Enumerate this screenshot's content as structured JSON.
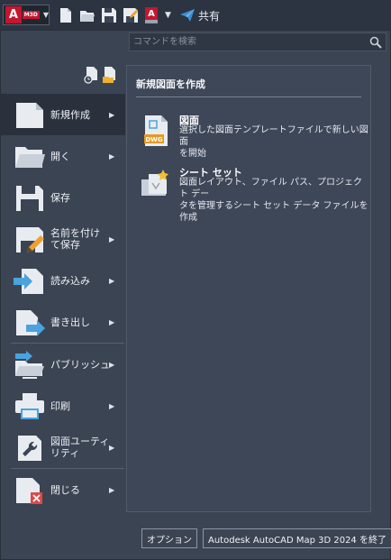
{
  "titlebar": {
    "app_logo": "A",
    "app_tag": "M3D",
    "qa_tag": "A",
    "share_label": "共有",
    "quick_access_icons": [
      "new-file-icon",
      "open-folder-icon",
      "save-icon",
      "saveas-icon",
      "autocad-lab-icon",
      "dropdown-icon"
    ]
  },
  "search": {
    "placeholder": "コマンドを検索"
  },
  "menu": {
    "items": [
      {
        "label": "新規作成",
        "icon": "new-document-icon",
        "active": true,
        "arrow": true
      },
      {
        "label": "開く",
        "icon": "open-folder-icon",
        "arrow": true
      },
      {
        "label": "保存",
        "icon": "save-icon",
        "arrow": false
      },
      {
        "label": "名前を付けて保存",
        "label_lines": [
          "名前を付け",
          "て保存"
        ],
        "icon": "save-as-icon",
        "arrow": true
      },
      {
        "label": "読み込み",
        "icon": "import-icon",
        "arrow": true
      },
      {
        "label": "書き出し",
        "icon": "export-icon",
        "arrow": true
      },
      {
        "label": "パブリッシュ",
        "icon": "publish-icon",
        "arrow": true
      },
      {
        "label": "印刷",
        "icon": "printer-icon",
        "arrow": true
      },
      {
        "label": "図面ユーティリティ",
        "label_lines": [
          "図面ユーティ",
          "リティ"
        ],
        "icon": "wrench-icon",
        "arrow": true
      },
      {
        "label": "閉じる",
        "icon": "close-document-icon",
        "arrow": true
      }
    ]
  },
  "panel": {
    "title": "新規図面を作成",
    "entries": [
      {
        "title": "図面",
        "description": "選択した図面テンプレートファイルで新しい図面を開始",
        "desc_lines": [
          "選択した図面テンプレートファイルで新しい図面",
          "を開始"
        ],
        "icon": "dwg-file-icon",
        "icon_text": "DWG"
      },
      {
        "title": "シート セット",
        "description": "図面レイアウト、ファイル パス、プロジェクト データを管理するシート セット データ ファイルを作成",
        "desc_lines": [
          "図面レイアウト、ファイル パス、プロジェクト デー",
          "タを管理するシート セット データ ファイルを作成"
        ],
        "icon": "sheet-set-icon"
      }
    ]
  },
  "footer": {
    "options_label": "オプション",
    "exit_label": "Autodesk AutoCAD Map 3D 2024 を終了"
  },
  "colors": {
    "background": "#3b4453",
    "titlebar": "#2b3440",
    "panel": "#3e4758",
    "active_item": "#2a313c",
    "brand_red": "#c3162f",
    "accent_blue": "#4aa3df"
  }
}
